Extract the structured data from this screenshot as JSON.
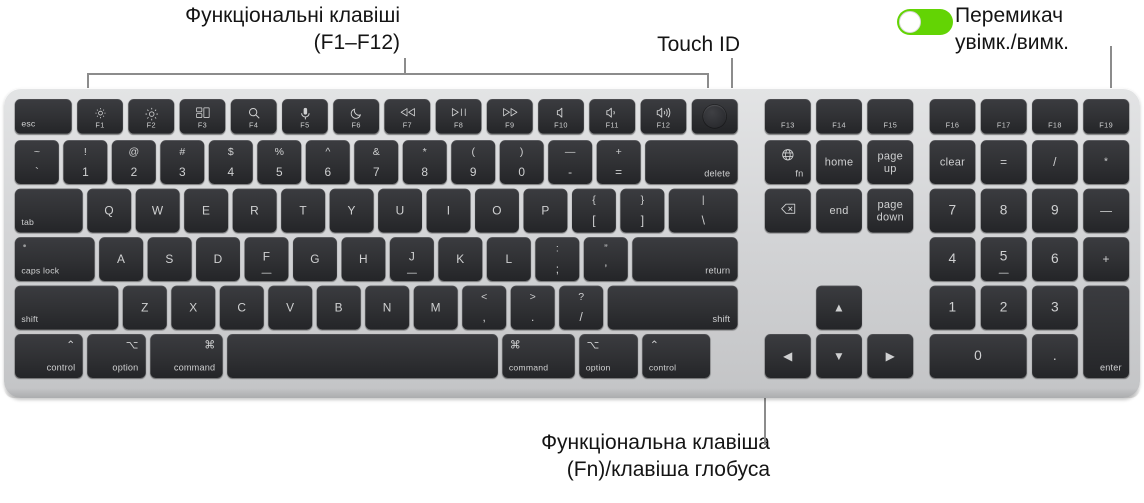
{
  "image": {
    "subject": "Apple Magic Keyboard with Touch ID and Numeric Keypad",
    "background_color": "#ffffff",
    "chassis_color": "#d4d5d7",
    "key_color": "#303134",
    "key_text_color": "#cfd0d1",
    "leader_line_color": "#8c8c8c"
  },
  "callouts": {
    "function_keys": "Функціональні клавіші\n(F1–F12)",
    "touch_id": "Touch ID",
    "power_switch": "Перемикач\nувімк./вимк.",
    "fn_globe_key": "Функціональна клавіша\n(Fn)/клавіша глобуса"
  },
  "power_toggle": {
    "state": "on",
    "track_color": "#63d404",
    "knob_color": "#ffffff"
  },
  "keyboard": {
    "function_row": [
      {
        "label": "esc",
        "icon": ""
      },
      {
        "label": "F1",
        "icon": "brightness-down-icon"
      },
      {
        "label": "F2",
        "icon": "brightness-up-icon"
      },
      {
        "label": "F3",
        "icon": "mission-control-icon"
      },
      {
        "label": "F4",
        "icon": "spotlight-search-icon"
      },
      {
        "label": "F5",
        "icon": "dictation-microphone-icon"
      },
      {
        "label": "F6",
        "icon": "do-not-disturb-moon-icon"
      },
      {
        "label": "F7",
        "icon": "rewind-icon"
      },
      {
        "label": "F8",
        "icon": "play-pause-icon"
      },
      {
        "label": "F9",
        "icon": "fast-forward-icon"
      },
      {
        "label": "F10",
        "icon": "mute-icon"
      },
      {
        "label": "F11",
        "icon": "volume-down-icon"
      },
      {
        "label": "F12",
        "icon": "volume-up-icon"
      },
      {
        "label": "",
        "icon": "touch-id-icon"
      }
    ],
    "number_row": [
      {
        "upper": "~",
        "lower": "`"
      },
      {
        "upper": "!",
        "lower": "1"
      },
      {
        "upper": "@",
        "lower": "2"
      },
      {
        "upper": "#",
        "lower": "3"
      },
      {
        "upper": "$",
        "lower": "4"
      },
      {
        "upper": "%",
        "lower": "5"
      },
      {
        "upper": "^",
        "lower": "6"
      },
      {
        "upper": "&",
        "lower": "7"
      },
      {
        "upper": "*",
        "lower": "8"
      },
      {
        "upper": "(",
        "lower": "9"
      },
      {
        "upper": ")",
        "lower": "0"
      },
      {
        "upper": "—",
        "lower": "-"
      },
      {
        "upper": "+",
        "lower": "="
      },
      {
        "label": "delete"
      }
    ],
    "top_row": {
      "tab": "tab",
      "letters": [
        "Q",
        "W",
        "E",
        "R",
        "T",
        "Y",
        "U",
        "I",
        "O",
        "P"
      ],
      "bracket_left": {
        "upper": "{",
        "lower": "["
      },
      "bracket_right": {
        "upper": "}",
        "lower": "]"
      },
      "backslash": {
        "upper": "|",
        "lower": "\\"
      }
    },
    "home_row": {
      "caps_lock": "caps lock",
      "letters": [
        "A",
        "S",
        "D",
        "F",
        "G",
        "H",
        "J",
        "K",
        "L"
      ],
      "semicolon": {
        "upper": ":",
        "lower": ";"
      },
      "quote": {
        "upper": "”",
        "lower": "’"
      },
      "return": "return"
    },
    "bottom_letter_row": {
      "shift_left": "shift",
      "letters": [
        "Z",
        "X",
        "C",
        "V",
        "B",
        "N",
        "M"
      ],
      "comma": {
        "upper": "<",
        "lower": ","
      },
      "period": {
        "upper": ">",
        "lower": "."
      },
      "slash": {
        "upper": "?",
        "lower": "/"
      },
      "shift_right": "shift"
    },
    "modifier_row": {
      "control_left": {
        "symbol": "⌃",
        "label": "control"
      },
      "option_left": {
        "symbol": "⌥",
        "label": "option"
      },
      "command_left": {
        "symbol": "⌘",
        "label": "command"
      },
      "space": "",
      "command_right": {
        "symbol": "⌘",
        "label": "command"
      },
      "option_right": {
        "symbol": "⌥",
        "label": "option"
      },
      "control_right": {
        "symbol": "⌃",
        "label": "control"
      }
    },
    "navigation_cluster": {
      "f_keys": [
        "F13",
        "F14",
        "F15"
      ],
      "fn_key": {
        "icon": "globe-icon",
        "label": "fn"
      },
      "home": "home",
      "page_up": "page\nup",
      "forward_delete": {
        "icon": "forward-delete-icon"
      },
      "end": "end",
      "page_down": "page\ndown",
      "arrows": {
        "up": "▲",
        "left": "◀",
        "down": "▼",
        "right": "▶"
      }
    },
    "numeric_keypad": {
      "f_keys": [
        "F16",
        "F17",
        "F18",
        "F19"
      ],
      "row1": [
        "clear",
        "=",
        "/",
        "*"
      ],
      "row2": [
        "7",
        "8",
        "9",
        "—"
      ],
      "row3": [
        "4",
        "5",
        "6",
        "+"
      ],
      "row4": [
        "1",
        "2",
        "3"
      ],
      "row5": [
        "0",
        "."
      ],
      "enter": "enter"
    }
  }
}
